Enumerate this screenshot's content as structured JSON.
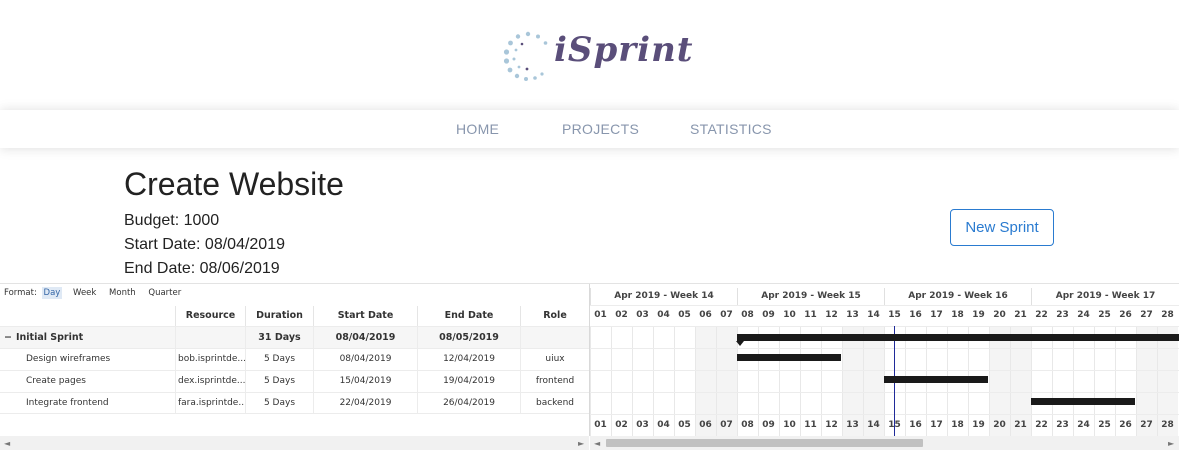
{
  "brand": {
    "name": "iSprint"
  },
  "nav": {
    "items": [
      {
        "label": "HOME"
      },
      {
        "label": "PROJECTS"
      },
      {
        "label": "STATISTICS"
      }
    ]
  },
  "project": {
    "title": "Create Website",
    "budget": "Budget: 1000",
    "start": "Start Date: 08/04/2019",
    "end": "End Date: 08/06/2019",
    "new_sprint_label": "New Sprint"
  },
  "gantt": {
    "format_label": "Format:",
    "formats": [
      "Day",
      "Week",
      "Month",
      "Quarter"
    ],
    "selected_format": "Day",
    "columns": [
      "Resource",
      "Duration",
      "Start Date",
      "End Date",
      "Role"
    ],
    "group": {
      "toggle": "−",
      "name": "Initial Sprint",
      "duration": "31 Days",
      "start": "08/04/2019",
      "end": "08/05/2019"
    },
    "tasks": [
      {
        "name": "Design wireframes",
        "resource": "bob.isprintde...",
        "duration": "5 Days",
        "start": "08/04/2019",
        "end": "12/04/2019",
        "role": "uiux"
      },
      {
        "name": "Create pages",
        "resource": "dex.isprintde...",
        "duration": "5 Days",
        "start": "15/04/2019",
        "end": "19/04/2019",
        "role": "frontend"
      },
      {
        "name": "Integrate frontend",
        "resource": "fara.isprintde...",
        "duration": "5 Days",
        "start": "22/04/2019",
        "end": "26/04/2019",
        "role": "backend"
      }
    ],
    "weeks": [
      "Apr 2019 - Week 14",
      "Apr 2019 - Week 15",
      "Apr 2019 - Week 16",
      "Apr 2019 - Week 17"
    ],
    "days": [
      "01",
      "02",
      "03",
      "04",
      "05",
      "06",
      "07",
      "08",
      "09",
      "10",
      "11",
      "12",
      "13",
      "14",
      "15",
      "16",
      "17",
      "18",
      "19",
      "20",
      "21",
      "22",
      "23",
      "24",
      "25",
      "26",
      "27",
      "28"
    ],
    "today_day": "15",
    "scroll": {
      "left_arrow": "◄",
      "right_arrow": "►"
    }
  },
  "icons": {
    "logo": "dotted-circle-logo",
    "collapse": "minus-toggle-icon"
  }
}
